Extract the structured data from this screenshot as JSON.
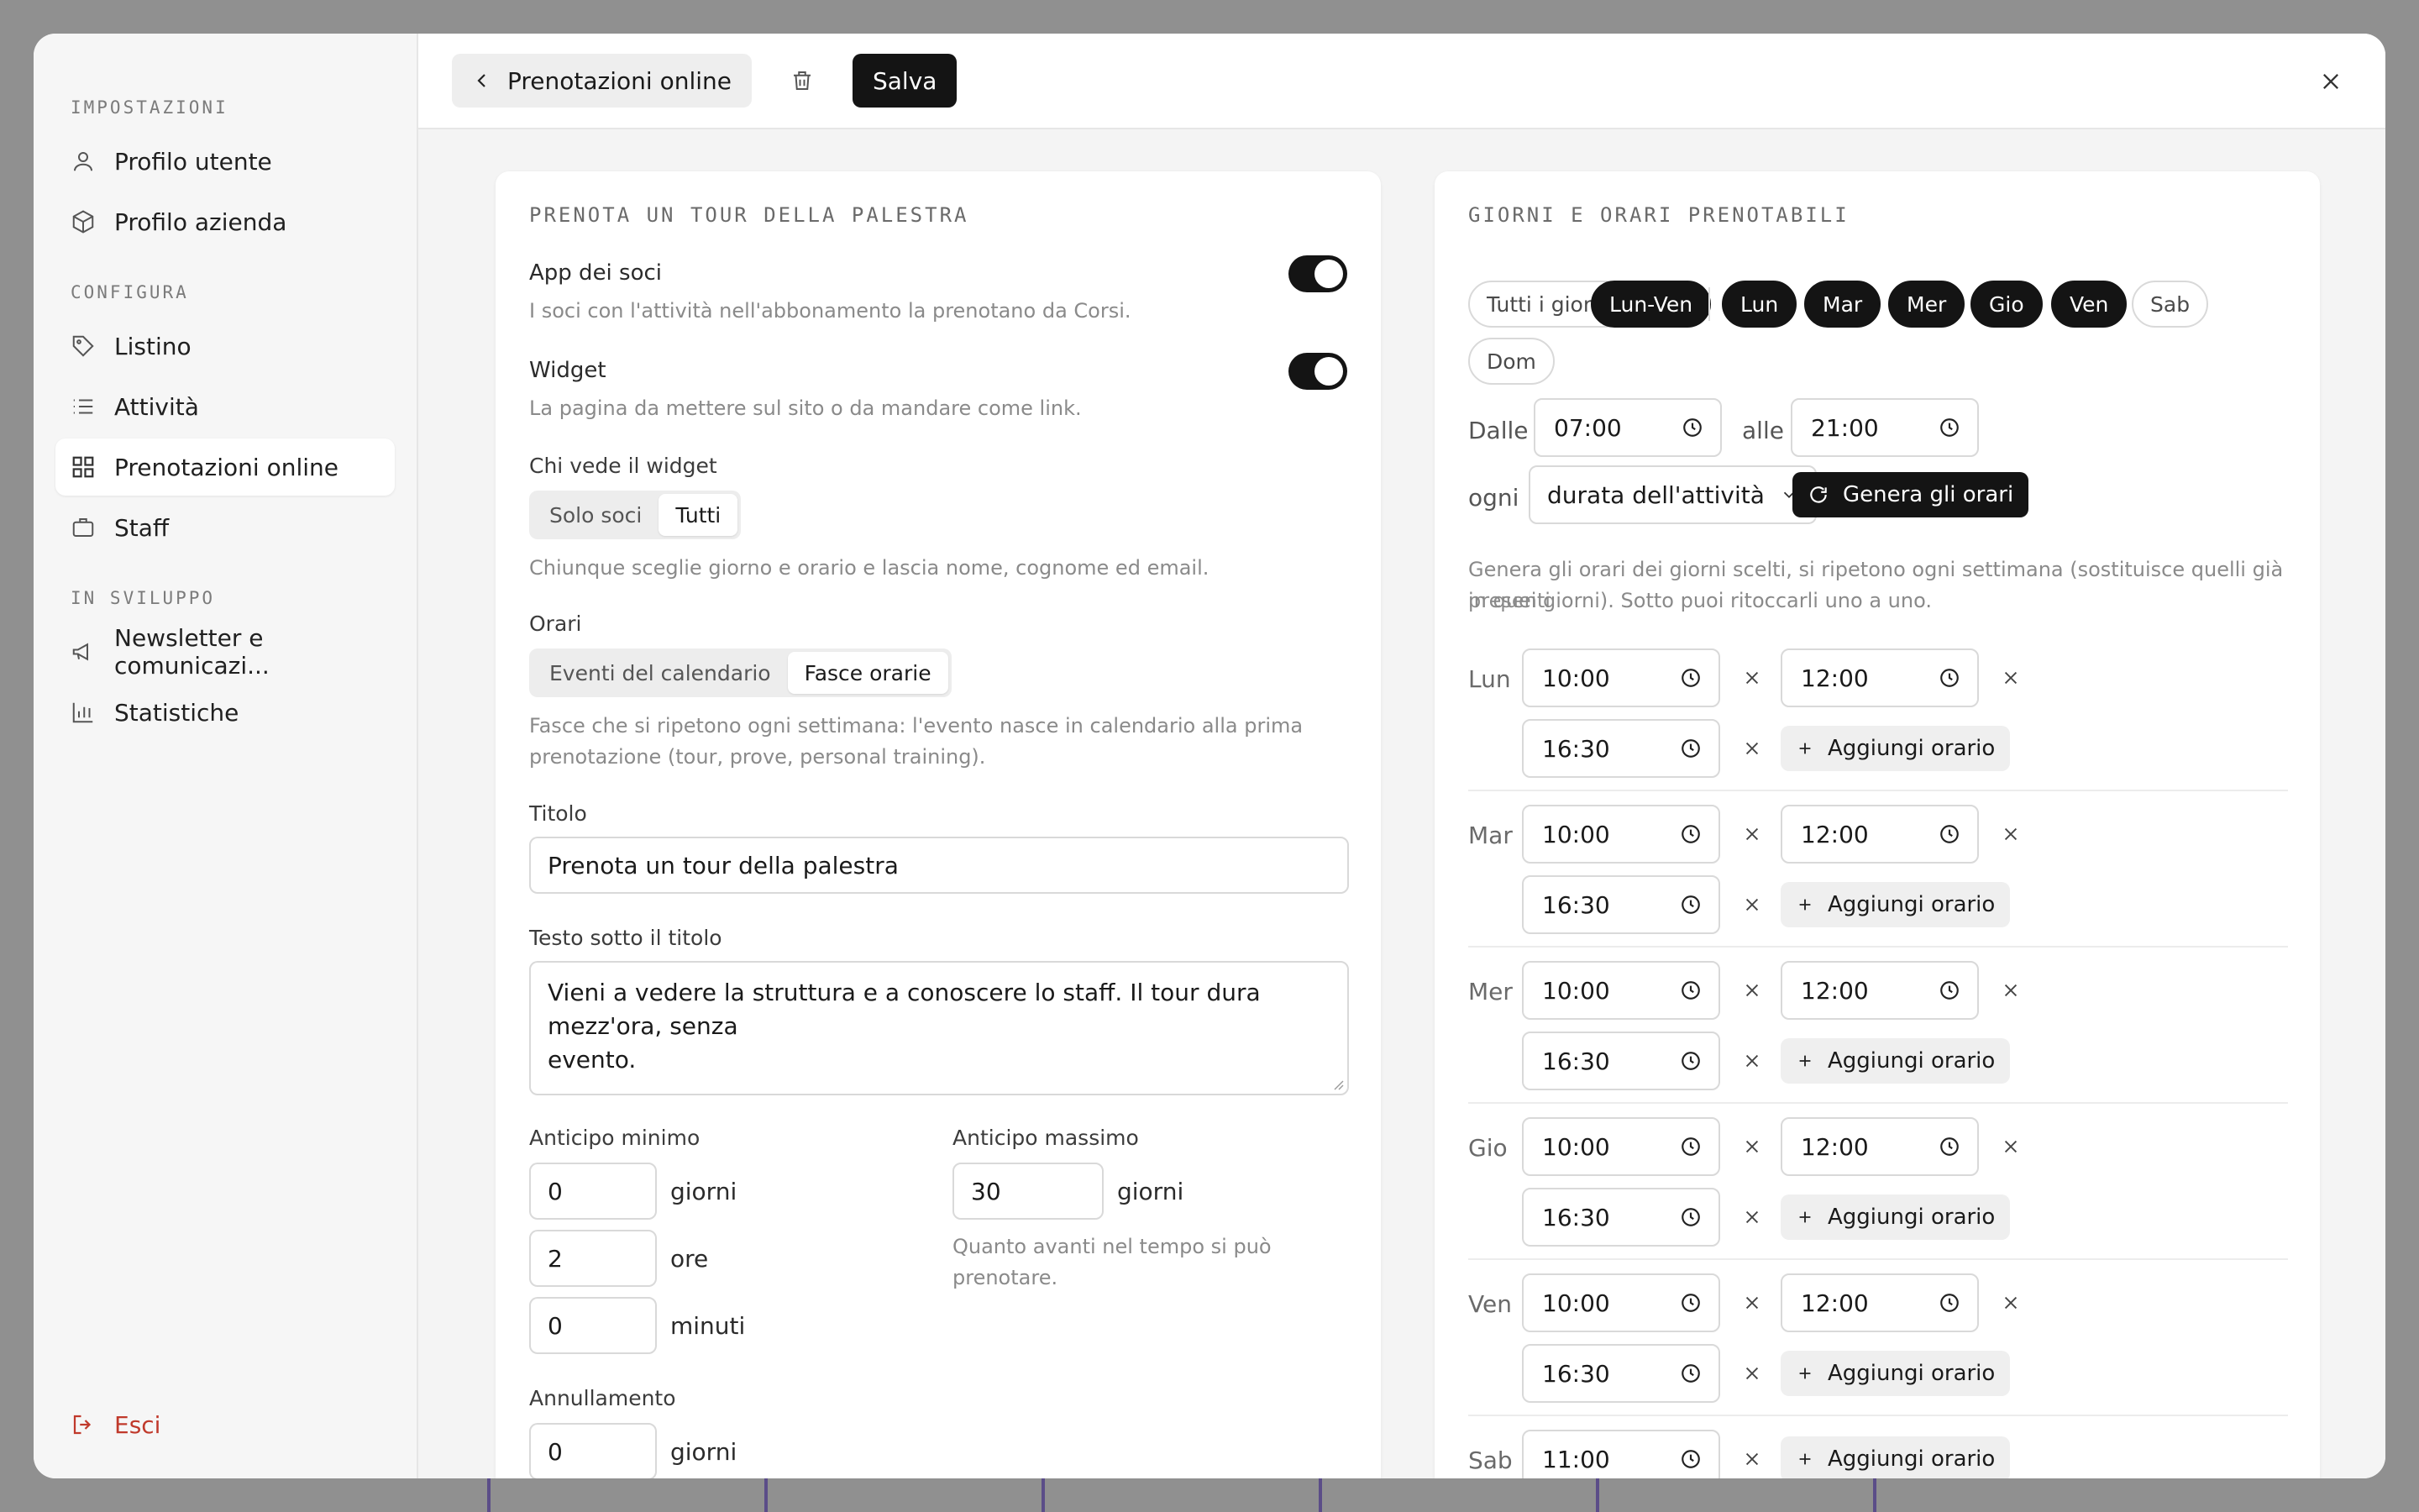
{
  "sidebar": {
    "section_settings": "IMPOSTAZIONI",
    "settings_items": [
      {
        "label": "Profilo utente",
        "icon": "user-icon"
      },
      {
        "label": "Profilo azienda",
        "icon": "box-icon"
      }
    ],
    "section_configure": "CONFIGURA",
    "configure_items": [
      {
        "label": "Listino",
        "icon": "tag-icon"
      },
      {
        "label": "Attività",
        "icon": "list-icon"
      },
      {
        "label": "Prenotazioni online",
        "icon": "grid-icon",
        "active": true
      },
      {
        "label": "Staff",
        "icon": "briefcase-icon"
      }
    ],
    "section_dev": "IN SVILUPPO",
    "dev_items": [
      {
        "label": "Newsletter e comunicazi...",
        "icon": "megaphone-icon"
      },
      {
        "label": "Statistiche",
        "icon": "bar-chart-icon"
      }
    ],
    "logout": "Esci"
  },
  "topbar": {
    "back_label": "Prenotazioni online",
    "save_label": "Salva"
  },
  "left": {
    "title": "PRENOTA UN TOUR DELLA PALESTRA",
    "app_label": "App dei soci",
    "app_hint": "I soci con l'attività nell'abbonamento la prenotano da Corsi.",
    "app_enabled": true,
    "widget_label": "Widget",
    "widget_hint": "La pagina da mettere sul sito o da mandare come link.",
    "widget_enabled": true,
    "who_label": "Chi vede il widget",
    "who_options": [
      "Solo soci",
      "Tutti"
    ],
    "who_selected": "Tutti",
    "who_hint": "Chiunque sceglie giorno e orario e lascia nome, cognome ed email.",
    "orari_label": "Orari",
    "orari_options": [
      "Eventi del calendario",
      "Fasce orarie"
    ],
    "orari_selected": "Fasce orarie",
    "orari_hint_1": "Fasce che si ripetono ogni settimana: l'evento nasce in calendario alla prima",
    "orari_hint_2": "prenotazione (tour, prove, personal training).",
    "titolo_label": "Titolo",
    "titolo_value": "Prenota un tour della palestra",
    "sotto_label": "Testo sotto il titolo",
    "sotto_line_1": "Vieni a vedere la struttura e a conoscere lo staff. Il tour dura mezz'ora, senza",
    "sotto_line_2": "evento.",
    "min_label": "Anticipo minimo",
    "min_days": "0",
    "min_hours": "2",
    "min_minutes": "0",
    "unit_days": "giorni",
    "unit_hours": "ore",
    "unit_minutes": "minuti",
    "max_label": "Anticipo massimo",
    "max_days": "30",
    "max_hint": "Quanto avanti nel tempo si può prenotare.",
    "cancel_label": "Annullamento",
    "cancel_days": "0"
  },
  "right": {
    "title": "GIORNI E ORARI PRENOTABILI",
    "chips": {
      "all": "Tutti i giorni",
      "weekdays": "Lun-Ven",
      "lun": "Lun",
      "mar": "Mar",
      "mer": "Mer",
      "gio": "Gio",
      "ven": "Ven",
      "sab": "Sab",
      "dom": "Dom"
    },
    "from_label": "Dalle",
    "from_value": "07:00",
    "to_label": "alle",
    "to_value": "21:00",
    "every_label": "ogni",
    "every_value": "durata dell'attività",
    "generate_label": "Genera gli orari",
    "gen_hint_1": "Genera gli orari dei giorni scelti, si ripetono ogni settimana (sostituisce quelli già presenti",
    "gen_hint_2": "in quei giorni). Sotto puoi ritoccarli uno a uno.",
    "add_label": "Aggiungi orario",
    "days": [
      {
        "name": "Lun",
        "times": [
          "10:00",
          "12:00",
          "16:30"
        ]
      },
      {
        "name": "Mar",
        "times": [
          "10:00",
          "12:00",
          "16:30"
        ]
      },
      {
        "name": "Mer",
        "times": [
          "10:00",
          "12:00",
          "16:30"
        ]
      },
      {
        "name": "Gio",
        "times": [
          "10:00",
          "12:00",
          "16:30"
        ]
      },
      {
        "name": "Ven",
        "times": [
          "10:00",
          "12:00",
          "16:30"
        ]
      },
      {
        "name": "Sab",
        "times": [
          "11:00"
        ]
      }
    ]
  }
}
